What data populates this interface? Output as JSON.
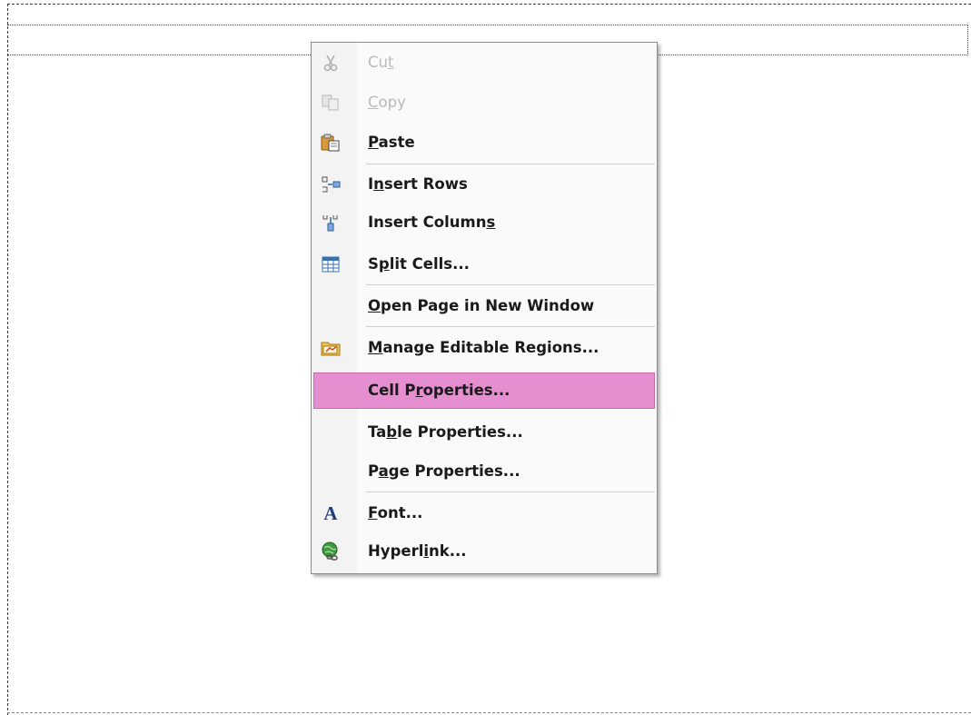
{
  "menu": {
    "items": [
      {
        "id": "cut",
        "label_pre": "Cu",
        "label_key": "t",
        "label_post": "",
        "icon": "scissors-icon",
        "disabled": true,
        "highlight": false
      },
      {
        "id": "copy",
        "label_pre": "",
        "label_key": "C",
        "label_post": "opy",
        "icon": "copy-icon",
        "disabled": true,
        "highlight": false
      },
      {
        "id": "paste",
        "label_pre": "",
        "label_key": "P",
        "label_post": "aste",
        "icon": "paste-icon",
        "disabled": false,
        "highlight": false
      },
      {
        "id": "insert-rows",
        "label_pre": "I",
        "label_key": "n",
        "label_post": "sert Rows",
        "icon": "insert-rows-icon",
        "disabled": false,
        "highlight": false
      },
      {
        "id": "insert-columns",
        "label_pre": "Insert Column",
        "label_key": "s",
        "label_post": "",
        "icon": "insert-columns-icon",
        "disabled": false,
        "highlight": false
      },
      {
        "id": "split-cells",
        "label_pre": "S",
        "label_key": "p",
        "label_post": "lit Cells...",
        "icon": "split-cells-icon",
        "disabled": false,
        "highlight": false
      },
      {
        "id": "open-page",
        "label_pre": "",
        "label_key": "O",
        "label_post": "pen Page in New Window",
        "icon": "",
        "disabled": false,
        "highlight": false
      },
      {
        "id": "manage-regions",
        "label_pre": "",
        "label_key": "M",
        "label_post": "anage Editable Regions...",
        "icon": "regions-icon",
        "disabled": false,
        "highlight": false
      },
      {
        "id": "cell-properties",
        "label_pre": "Cell P",
        "label_key": "r",
        "label_post": "operties...",
        "icon": "",
        "disabled": false,
        "highlight": true
      },
      {
        "id": "table-properties",
        "label_pre": "Ta",
        "label_key": "b",
        "label_post": "le Properties...",
        "icon": "",
        "disabled": false,
        "highlight": false
      },
      {
        "id": "page-properties",
        "label_pre": "P",
        "label_key": "a",
        "label_post": "ge Properties...",
        "icon": "",
        "disabled": false,
        "highlight": false
      },
      {
        "id": "font",
        "label_pre": "",
        "label_key": "F",
        "label_post": "ont...",
        "icon": "font-icon",
        "disabled": false,
        "highlight": false
      },
      {
        "id": "hyperlink",
        "label_pre": "Hyperl",
        "label_key": "i",
        "label_post": "nk...",
        "icon": "hyperlink-icon",
        "disabled": false,
        "highlight": false
      }
    ]
  },
  "colors": {
    "highlight": "#e58ed0",
    "disabled_text": "#b9b9b9"
  }
}
